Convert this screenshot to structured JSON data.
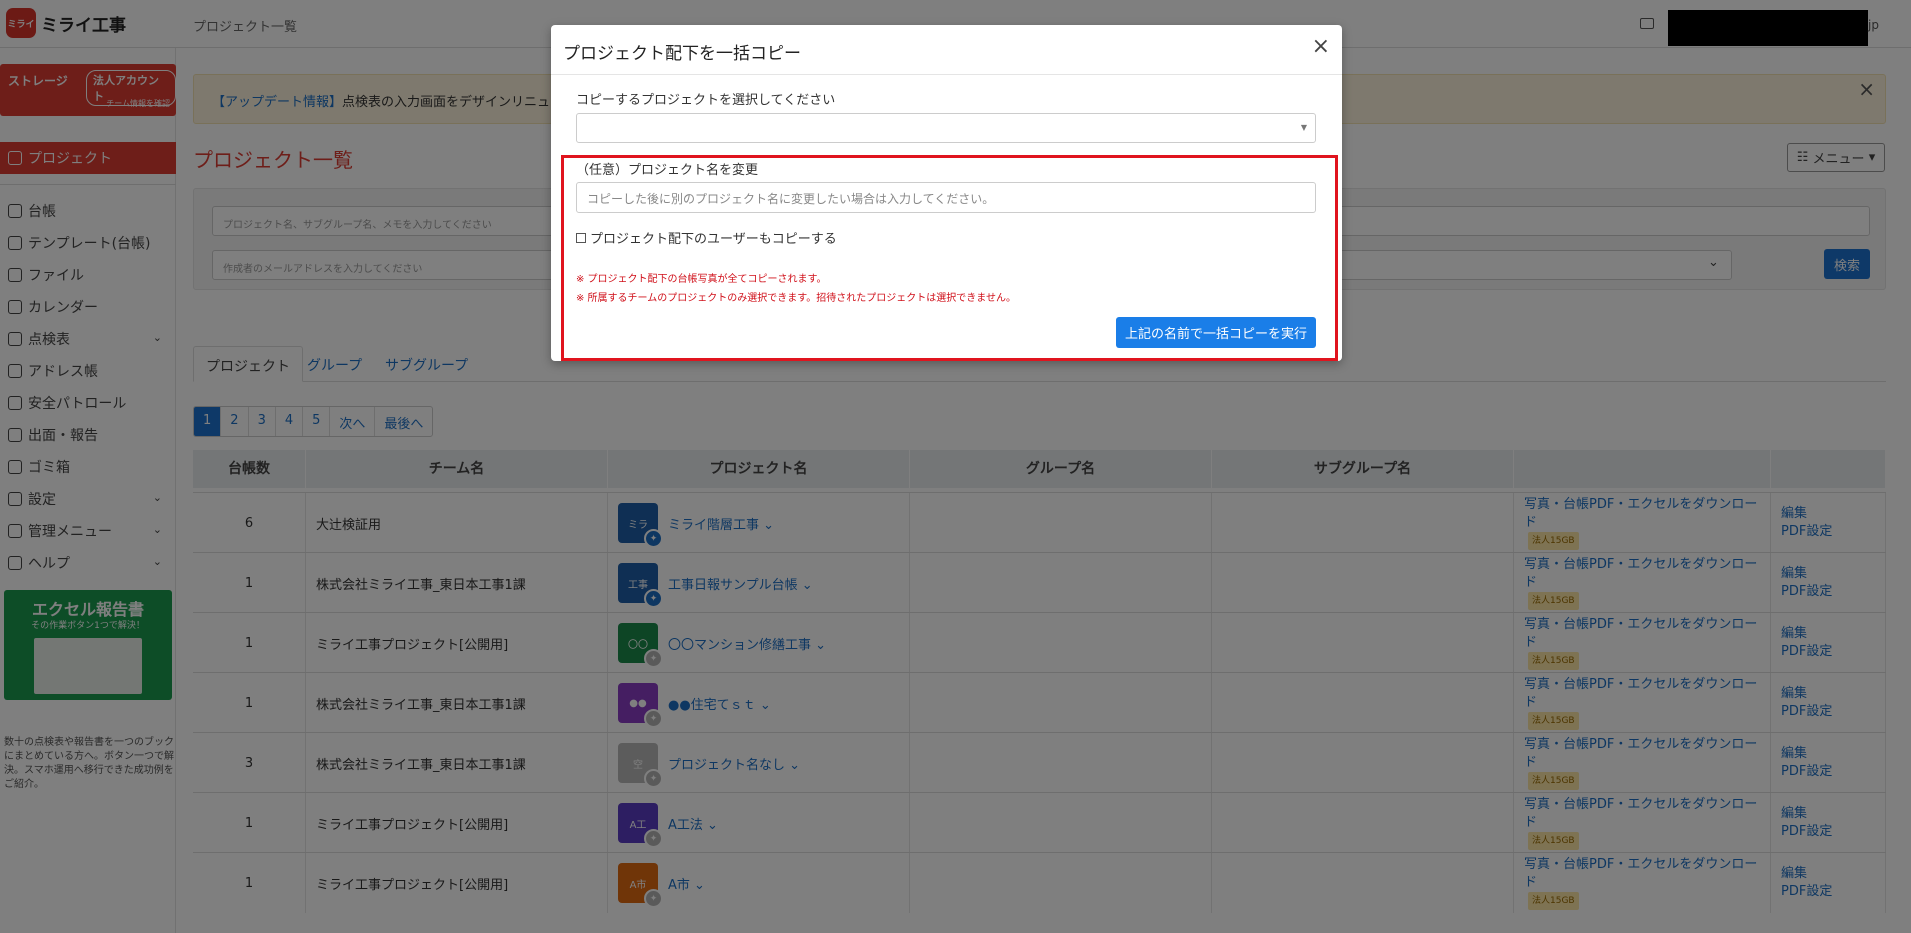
{
  "app": {
    "logo_mark": "ミライ",
    "logo_text": "ミライ工事",
    "breadcrumb": "プロジェクト一覧",
    "user_tail": "jp"
  },
  "sidebar": {
    "storage_title": "ストレージ",
    "storage_badge": "法人アカウント",
    "storage_link": "チーム情報を確認",
    "items": [
      {
        "label": "プロジェクト"
      },
      {
        "label": "台帳"
      },
      {
        "label": "テンプレート(台帳)"
      },
      {
        "label": "ファイル"
      },
      {
        "label": "カレンダー"
      },
      {
        "label": "点検表"
      },
      {
        "label": "アドレス帳"
      },
      {
        "label": "安全パトロール"
      },
      {
        "label": "出面・報告"
      },
      {
        "label": "ゴミ箱"
      },
      {
        "label": "設定"
      },
      {
        "label": "管理メニュー"
      },
      {
        "label": "ヘルプ"
      }
    ],
    "promo_title": "エクセル報告書",
    "promo_sub": "その作業ボタン1つで解決！",
    "promo_desc": "数十の点検表や報告書を一つのブックにまとめている方へ。ボタン一つで解決。スマホ運用へ移行できた成功例をご紹介。"
  },
  "alert": {
    "link": "【アップデート情報】",
    "text": "点検表の入力画面をデザインリニュー"
  },
  "main": {
    "title": "プロジェクト一覧",
    "menu_label": "メニュー",
    "search_placeholder": "プロジェクト名、サブグループ名、メモを入力してください",
    "email_placeholder": "作成者のメールアドレスを入力してください",
    "search_btn": "検索",
    "tabs": [
      "プロジェクト",
      "グループ",
      "サブグループ"
    ],
    "pages": [
      "1",
      "2",
      "3",
      "4",
      "5",
      "次へ",
      "最後へ"
    ]
  },
  "table": {
    "headers": [
      "台帳数",
      "チーム名",
      "プロジェクト名",
      "グループ名",
      "サブグループ名",
      "",
      ""
    ],
    "download_text": "写真・台帳PDF・エクセルをダウンロード",
    "badge_text": "法人15GB",
    "edit": "編集",
    "pdf": "PDF設定",
    "rows": [
      {
        "count": "6",
        "team": "大辻検証用",
        "thumb": "ミラ",
        "color": "#1f5fa8",
        "pinned": true,
        "project": "ミライ階層工事"
      },
      {
        "count": "1",
        "team": "株式会社ミライ工事_東日本工事1課",
        "thumb": "工事",
        "color": "#1f5fa8",
        "pinned": true,
        "project": "工事日報サンプル台帳"
      },
      {
        "count": "1",
        "team": "ミライ工事プロジェクト[公開用]",
        "thumb": "〇〇",
        "color": "#1a8a4a",
        "pinned": false,
        "project": "〇〇マンション修繕工事"
      },
      {
        "count": "1",
        "team": "株式会社ミライ工事_東日本工事1課",
        "thumb": "●●",
        "color": "#8a3cc4",
        "pinned": false,
        "project": "●●住宅てｓｔ"
      },
      {
        "count": "3",
        "team": "株式会社ミライ工事_東日本工事1課",
        "thumb": "空",
        "color": "#b9b9b9",
        "pinned": false,
        "project": "プロジェクト名なし"
      },
      {
        "count": "1",
        "team": "ミライ工事プロジェクト[公開用]",
        "thumb": "A工",
        "color": "#5b3cc4",
        "pinned": false,
        "project": "A工法"
      },
      {
        "count": "1",
        "team": "ミライ工事プロジェクト[公開用]",
        "thumb": "A市",
        "color": "#e06a10",
        "pinned": false,
        "project": "A市"
      }
    ]
  },
  "modal": {
    "title": "プロジェクト配下を一括コピー",
    "close": "×",
    "select_label": "コピーするプロジェクトを選択してください",
    "rename_label": "（任意）プロジェクト名を変更",
    "rename_placeholder": "コピーした後に別のプロジェクト名に変更したい場合は入力してください。",
    "copy_users_label": "プロジェクト配下のユーザーもコピーする",
    "note1": "※ プロジェクト配下の台帳写真が全てコピーされます。",
    "note2": "※ 所属するチームのプロジェクトのみ選択できます。招待されたプロジェクトは選択できません。",
    "execute": "上記の名前で一括コピーを実行"
  },
  "colors": {
    "brand": "#dc3c33",
    "primary": "#1a7ee8",
    "highlight": "#e0141e"
  }
}
